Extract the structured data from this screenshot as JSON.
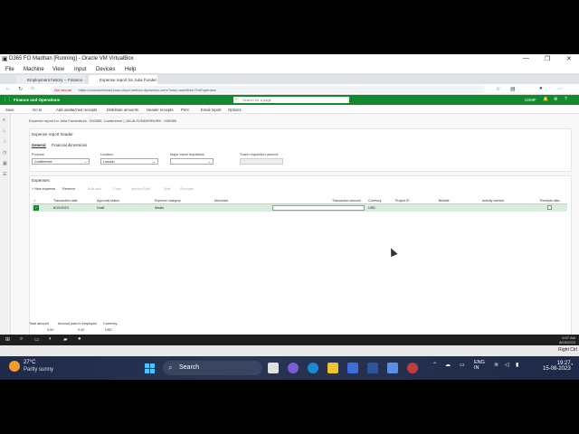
{
  "vbox": {
    "title": "D365 FO Madhan [Running] - Oracle VM VirtualBox",
    "menu": [
      "File",
      "Machine",
      "View",
      "Input",
      "Devices",
      "Help"
    ],
    "status_right": "Right Ctrl"
  },
  "browser": {
    "tabs": [
      "Employment history -- Finance ...",
      "Expense report for Julia Funder..."
    ],
    "security": "Not secure",
    "url": "https://usnconeboxax1aos.cloud.onebox.dynamics.com/?cmp=usmf&mi=TrvExpenses"
  },
  "d365": {
    "app_name": "Finance and Operations",
    "search_placeholder": "Search for a page",
    "company": "USMF",
    "actions": [
      "Save",
      "Go to",
      "Add unattached receipts",
      "Distribute amounts",
      "Header receipts",
      "Print",
      "Email report",
      "Options"
    ],
    "breadcrumb": "Expense report for Julia Funderburk : 000085, Conference  |  JULIA FUNDERBURK : 000085",
    "header": {
      "title": "Expense report header",
      "tabs": [
        "General",
        "Financial dimensions"
      ],
      "fields": {
        "purpose_label": "Purpose",
        "purpose_value": "Conference",
        "location_label": "Location",
        "location_value": "London",
        "major_travel_label": "Major travel requisition",
        "major_travel_value": "",
        "travel_req_amount_label": "Travel requisition amount",
        "travel_req_amount_value": ""
      }
    },
    "lines": {
      "title": "Expenses",
      "toolbar": [
        "+ New expense",
        "Remove",
        "Bulk add",
        "Copy",
        "Itemize/Split",
        "Split",
        "Receipts"
      ],
      "columns": [
        "Transaction date",
        "Approval status",
        "Expense category",
        "Merchant",
        "Transaction amount",
        "Currency",
        "Project ID",
        "Billable",
        "Activity number",
        "Receipts atta..."
      ],
      "row": {
        "date": "8/15/2023",
        "status": "Draft",
        "category": "Meals",
        "merchant": "",
        "amount": "",
        "currency": "USD"
      }
    },
    "totals": {
      "total_label": "Total amount",
      "paid_label": "Amount paid to employee",
      "currency_label": "Currency",
      "total_value": "0.00",
      "paid_value": "0.00",
      "currency_value": "USD"
    }
  },
  "guest_clock": {
    "time": "6:57 AM",
    "date": "8/15/2023"
  },
  "host": {
    "temp": "27°C",
    "weather": "Partly sunny",
    "search_label": "Search",
    "lang": "ENG",
    "region": "IN",
    "time": "19:27",
    "date": "15-08-2023"
  }
}
